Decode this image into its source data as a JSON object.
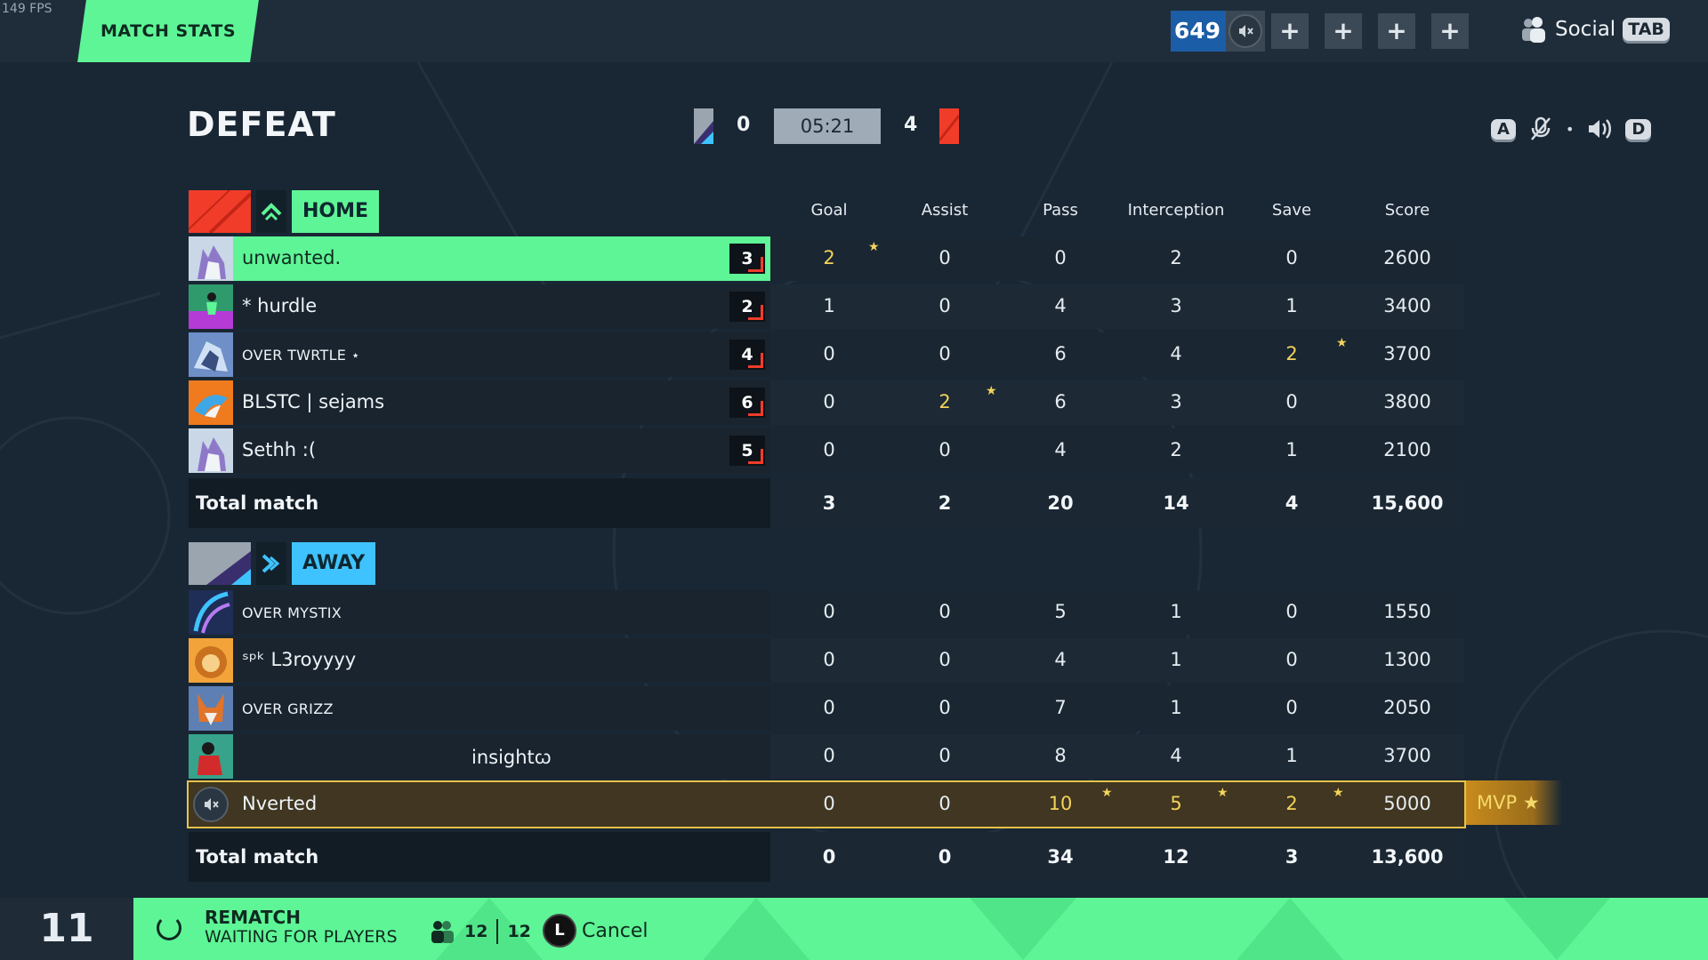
{
  "fps": "149 FPS",
  "tab": "MATCH STATS",
  "currency": "649",
  "topbar_buttons": [
    "+",
    "+",
    "+",
    "+"
  ],
  "social": {
    "label": "Social",
    "key": "TAB"
  },
  "header": {
    "result": "DEFEAT",
    "home_score": "0",
    "away_score": "4",
    "timer": "05:21",
    "key_left": "A",
    "key_right": "D",
    "separator": "•"
  },
  "columns": [
    "Goal",
    "Assist",
    "Pass",
    "Interception",
    "Save",
    "Score"
  ],
  "home": {
    "name": "HOME",
    "players": [
      {
        "name": "unwanted.",
        "level": "3",
        "stats": [
          "2",
          "0",
          "0",
          "2",
          "0",
          "2600"
        ]
      },
      {
        "name": "* hurdle",
        "level": "2",
        "stats": [
          "1",
          "0",
          "4",
          "3",
          "1",
          "3400"
        ]
      },
      {
        "name": "OVER TWRTLE ⋆",
        "level": "4",
        "stats": [
          "0",
          "0",
          "6",
          "4",
          "2",
          "3700"
        ]
      },
      {
        "name": "BLSTC | sejams",
        "level": "6",
        "stats": [
          "0",
          "2",
          "6",
          "3",
          "0",
          "3800"
        ]
      },
      {
        "name": "Sethh :(",
        "level": "5",
        "stats": [
          "0",
          "0",
          "4",
          "2",
          "1",
          "2100"
        ]
      }
    ],
    "total_label": "Total match",
    "totals": [
      "3",
      "2",
      "20",
      "14",
      "4",
      "15,600"
    ]
  },
  "away": {
    "name": "AWAY",
    "players": [
      {
        "name": "OVER MYSTIX",
        "stats": [
          "0",
          "0",
          "5",
          "1",
          "0",
          "1550"
        ]
      },
      {
        "name": "ˢᵖᵏ L3royyyy",
        "stats": [
          "0",
          "0",
          "4",
          "1",
          "0",
          "1300"
        ]
      },
      {
        "name": "OVER GRIZZ",
        "stats": [
          "0",
          "0",
          "7",
          "1",
          "0",
          "2050"
        ]
      },
      {
        "name": "insightꞷ",
        "stats": [
          "0",
          "0",
          "8",
          "4",
          "1",
          "3700"
        ]
      },
      {
        "name": "Nverted",
        "stats": [
          "0",
          "0",
          "10",
          "5",
          "2",
          "5000"
        ]
      }
    ],
    "total_label": "Total match",
    "totals": [
      "0",
      "0",
      "34",
      "12",
      "3",
      "13,600"
    ]
  },
  "mvp_label": "MVP ★",
  "bottom": {
    "countdown": "11",
    "title": "REMATCH",
    "subtitle": "WAITING FOR PLAYERS",
    "players_ready": "12",
    "players_total": "12",
    "cancel_key": "L",
    "cancel_label": "Cancel"
  },
  "colors": {
    "accent_green": "#5ef596",
    "away_blue": "#3fc3ff",
    "home_red": "#f23c2a",
    "mvp_gold": "#e6c34a",
    "star_yellow": "#f4d45b"
  }
}
